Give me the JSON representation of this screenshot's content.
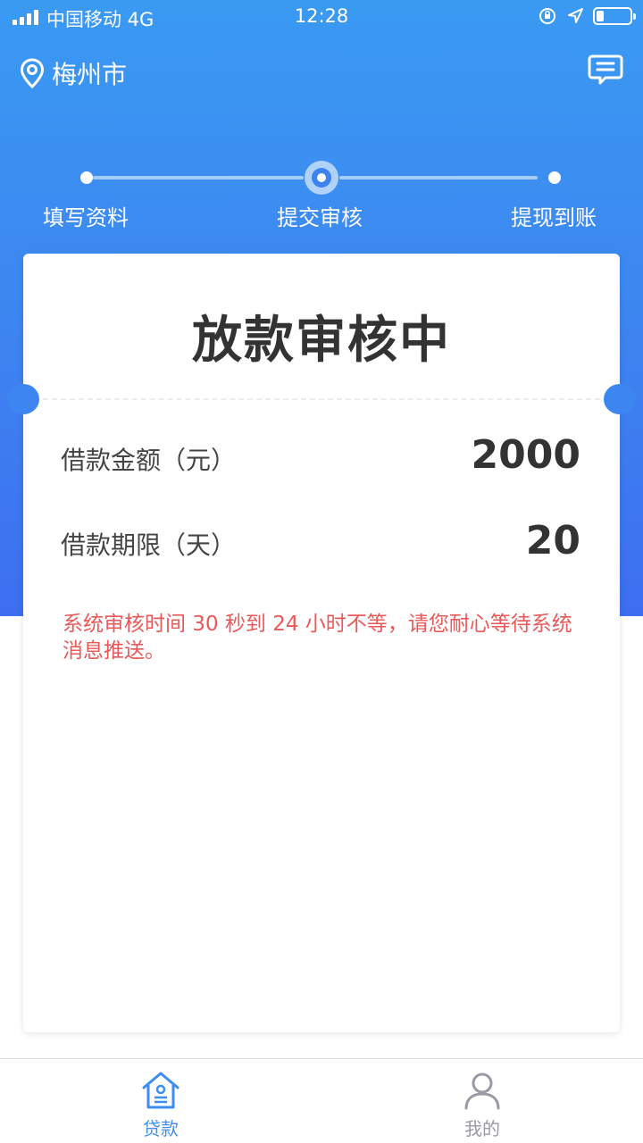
{
  "status_bar": {
    "carrier": "中国移动  4G",
    "time": "12:28"
  },
  "header": {
    "city": "梅州市",
    "location_icon": "location-pin-icon",
    "message_icon": "message-icon"
  },
  "steps": [
    {
      "label": "填写资料",
      "state": "done"
    },
    {
      "label": "提交审核",
      "state": "active"
    },
    {
      "label": "提现到账",
      "state": "pending"
    }
  ],
  "card": {
    "title": "放款审核中",
    "amount_label": "借款金额（元）",
    "amount_value": "2000",
    "term_label": "借款期限（天）",
    "term_value": "20",
    "notice": "系统审核时间 30 秒到 24 小时不等，请您耐心等待系统消息推送。"
  },
  "tabbar": {
    "tabs": [
      {
        "label": "贷款",
        "icon": "home-icon",
        "active": true
      },
      {
        "label": "我的",
        "icon": "user-icon",
        "active": false
      }
    ]
  },
  "colors": {
    "primary": "#3d82f0",
    "notice_red": "#e85a5a",
    "tab_active": "#3d8ef2",
    "tab_inactive": "#9a9aa6"
  }
}
